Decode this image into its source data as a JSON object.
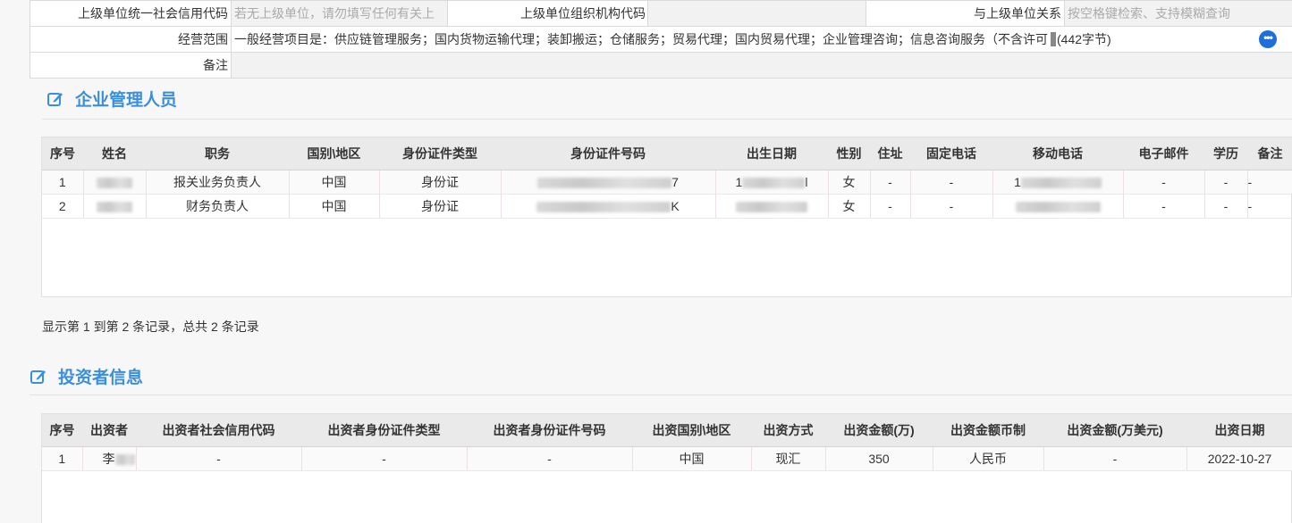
{
  "top_form": {
    "row1": {
      "label1": "上级单位统一社会信用代码",
      "placeholder1": "若无上级单位，请勿填写任何有关上",
      "label2": "上级单位组织机构代码",
      "value2": "",
      "label3": "与上级单位关系",
      "placeholder3": "按空格键检索、支持模糊查询"
    },
    "row2": {
      "label": "经营范围",
      "value": "一般经营项目是：供应链管理服务；国内货物运输代理；装卸搬运；仓储服务；贸易代理；国内贸易代理；企业管理咨询；信息咨询服务（不含许可",
      "count": "(442字节)",
      "more_icon": "ellipsis-icon"
    },
    "row3": {
      "label": "备注",
      "value": ""
    }
  },
  "managers": {
    "title": "企业管理人员",
    "icon": "edit-icon",
    "columns": [
      "序号",
      "姓名",
      "职务",
      "国别\\地区",
      "身份证件类型",
      "身份证件号码",
      "出生日期",
      "性别",
      "住址",
      "固定电话",
      "移动电话",
      "电子邮件",
      "学历",
      "备注"
    ],
    "rows": [
      {
        "no": "1",
        "name_vis": "",
        "position": "报关业务负责人",
        "country": "中国",
        "id_type": "身份证",
        "id_no_tail": "7",
        "birth_head": "1",
        "birth_tail": "l",
        "gender": "女",
        "address": "-",
        "phone": "-",
        "mobile_head": "1",
        "email": "-",
        "edu": "-",
        "remark": "-"
      },
      {
        "no": "2",
        "name_vis": "",
        "position": "财务负责人",
        "country": "中国",
        "id_type": "身份证",
        "id_no_tail": "K",
        "birth_head": "",
        "birth_tail": "",
        "gender": "女",
        "address": "-",
        "phone": "-",
        "mobile_head": "",
        "email": "-",
        "edu": "-",
        "remark": "-"
      }
    ],
    "pager": "显示第 1 到第 2 条记录，总共 2 条记录"
  },
  "investors": {
    "title": "投资者信息",
    "icon": "edit-icon",
    "columns": [
      "序号",
      "出资者",
      "出资者社会信用代码",
      "出资者身份证件类型",
      "出资者身份证件号码",
      "出资国别\\地区",
      "出资方式",
      "出资金额(万)",
      "出资金额币制",
      "出资金额(万美元)",
      "出资日期"
    ],
    "rows": [
      {
        "no": "1",
        "investor_vis": "李",
        "credit_code": "-",
        "id_type": "-",
        "id_no": "-",
        "country": "中国",
        "method": "现汇",
        "amount": "350",
        "currency": "人民币",
        "amount_usd": "-",
        "date": "2022-10-27"
      }
    ]
  }
}
